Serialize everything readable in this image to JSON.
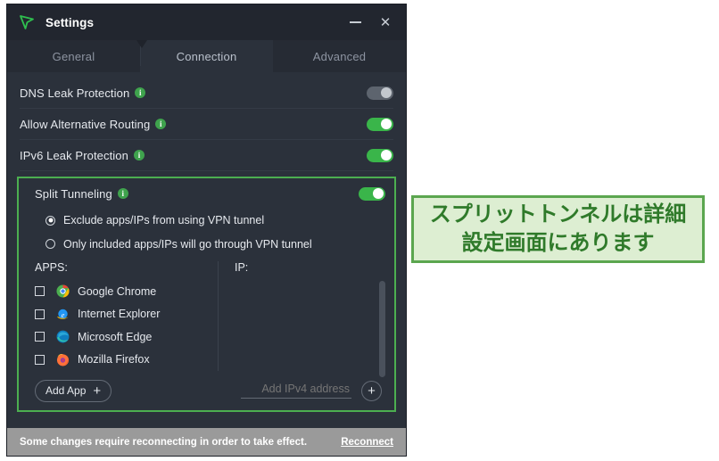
{
  "window": {
    "title": "Settings",
    "logo_icon": "vpn-arrow-logo-icon",
    "minimize_label": "—",
    "close_label": "✕"
  },
  "tabs": [
    {
      "label": "General",
      "active": false
    },
    {
      "label": "Connection",
      "active": true
    },
    {
      "label": "Advanced",
      "active": false
    }
  ],
  "settings": [
    {
      "label": "DNS Leak Protection",
      "info": "i",
      "toggle": "off"
    },
    {
      "label": "Allow Alternative Routing",
      "info": "i",
      "toggle": "on"
    },
    {
      "label": "IPv6 Leak Protection",
      "info": "i",
      "toggle": "on"
    }
  ],
  "split_tunneling": {
    "label": "Split Tunneling",
    "info": "i",
    "toggle": "on",
    "highlight_color": "#4caf50",
    "options": [
      {
        "label": "Exclude apps/IPs from using VPN tunnel",
        "selected": true
      },
      {
        "label": "Only included apps/IPs will go through VPN tunnel",
        "selected": false
      }
    ],
    "apps_column_title": "APPS:",
    "ip_column_title": "IP:",
    "apps": [
      {
        "name": "Google Chrome",
        "icon": "chrome-icon",
        "checked": false
      },
      {
        "name": "Internet Explorer",
        "icon": "internet-explorer-icon",
        "checked": false
      },
      {
        "name": "Microsoft Edge",
        "icon": "edge-icon",
        "checked": false
      },
      {
        "name": "Mozilla Firefox",
        "icon": "firefox-icon",
        "checked": false
      }
    ],
    "add_app_label": "Add App",
    "add_app_plus": "+",
    "add_ip_placeholder": "Add IPv4 address",
    "add_ip_value": "",
    "add_ip_plus": "+"
  },
  "status_bar": {
    "message": "Some changes require reconnecting in order to take effect.",
    "action_label": "Reconnect",
    "background": "#9a9a9a"
  },
  "callout": {
    "line1": "スプリットトンネルは詳細",
    "line2": "設定画面にあります",
    "text_color": "#2f7a2a",
    "background": "#ddeed2",
    "border_color": "#5ba64f"
  }
}
